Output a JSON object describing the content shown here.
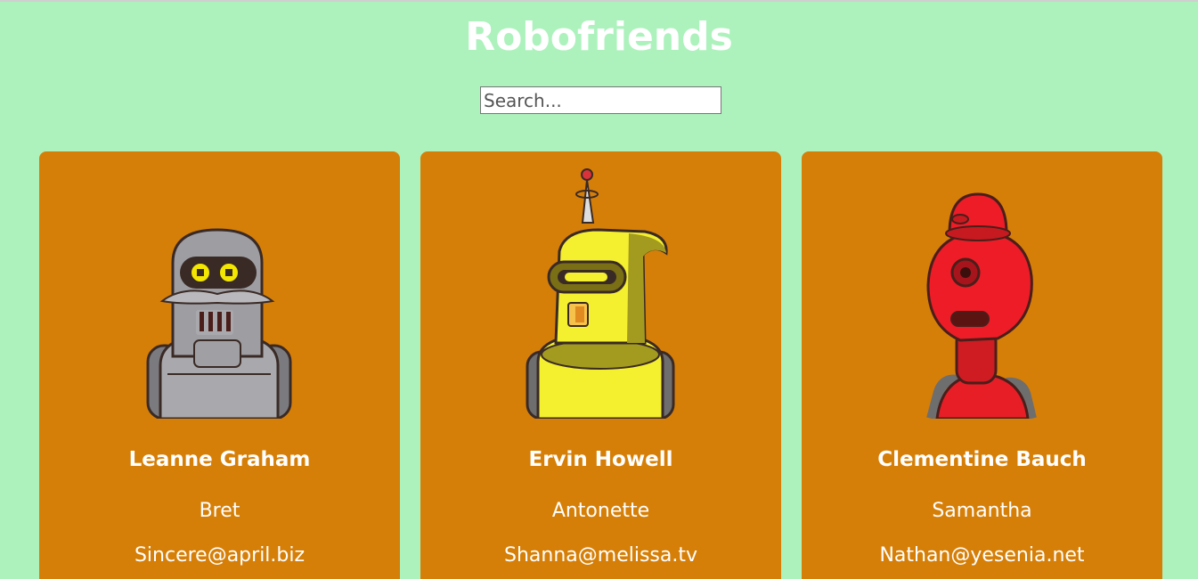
{
  "app": {
    "title": "Robofriends"
  },
  "search": {
    "placeholder": "Search...",
    "value": ""
  },
  "colors": {
    "background": "#adf2bd",
    "card": "#d67f08",
    "text": "#ffffff"
  },
  "robots": [
    {
      "name": "Leanne Graham",
      "username": "Bret",
      "email": "Sincere@april.biz",
      "avatar": "grey-robot-avatar"
    },
    {
      "name": "Ervin Howell",
      "username": "Antonette",
      "email": "Shanna@melissa.tv",
      "avatar": "yellow-robot-avatar"
    },
    {
      "name": "Clementine Bauch",
      "username": "Samantha",
      "email": "Nathan@yesenia.net",
      "avatar": "red-robot-avatar"
    }
  ]
}
